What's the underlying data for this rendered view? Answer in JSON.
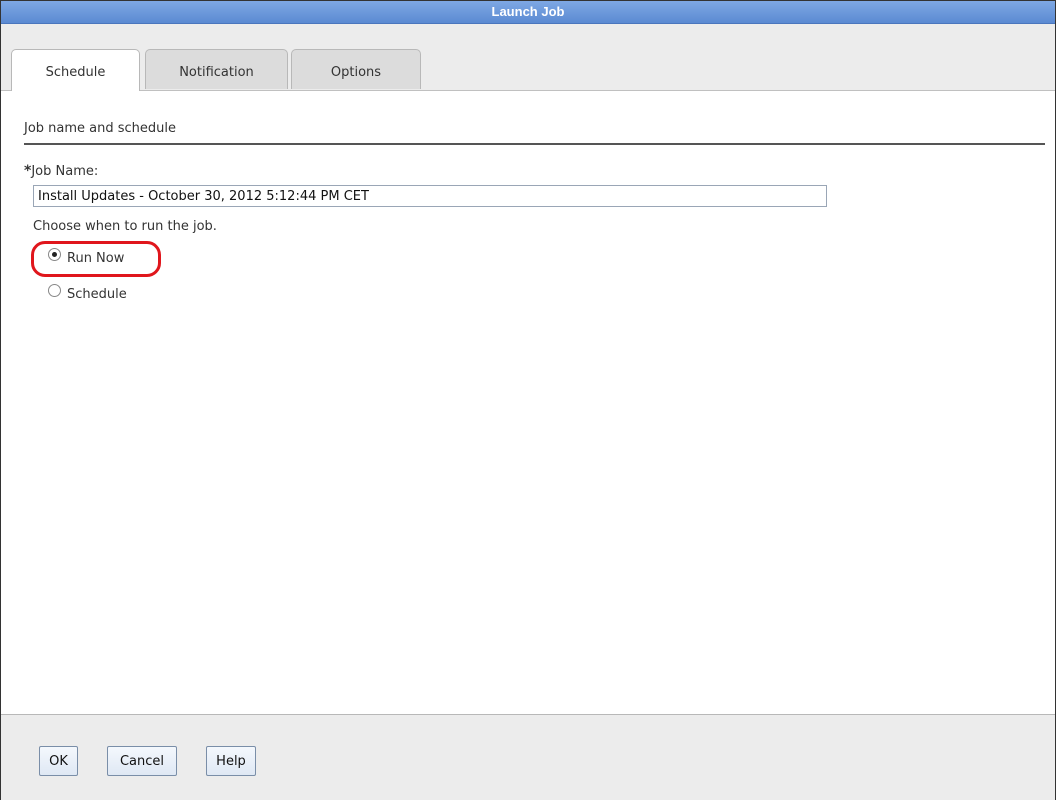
{
  "window": {
    "title": "Launch Job"
  },
  "tabs": [
    {
      "label": "Schedule",
      "active": true
    },
    {
      "label": "Notification",
      "active": false
    },
    {
      "label": "Options",
      "active": false
    }
  ],
  "section": {
    "title": "Job name and schedule"
  },
  "job_name": {
    "required_marker": "*",
    "label": "Job Name:",
    "value": "Install Updates - October 30, 2012 5:12:44 PM CET"
  },
  "run_choice": {
    "prompt": "Choose when to run the job.",
    "options": [
      {
        "label": "Run Now",
        "selected": true
      },
      {
        "label": "Schedule",
        "selected": false
      }
    ]
  },
  "buttons": {
    "ok": "OK",
    "cancel": "Cancel",
    "help": "Help"
  },
  "colors": {
    "title_bar": "#5b8ad2",
    "highlight": "#e0161c"
  }
}
